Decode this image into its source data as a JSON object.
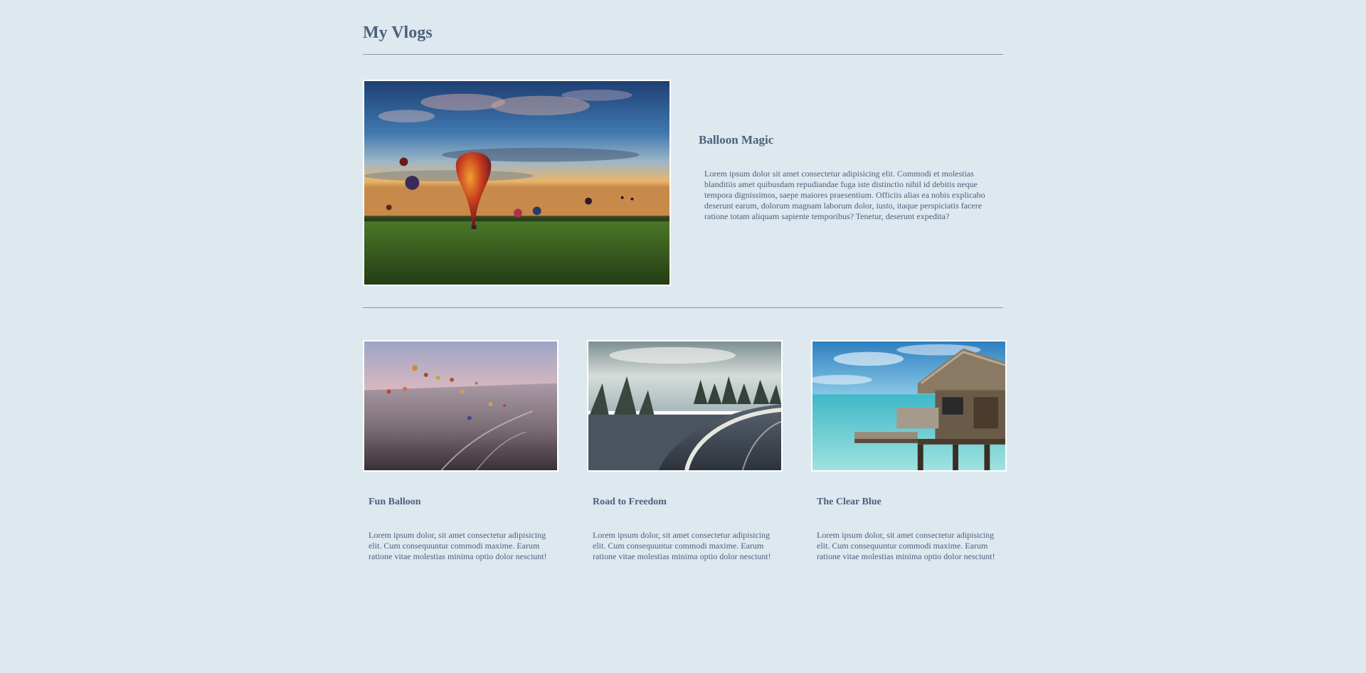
{
  "page": {
    "title": "My Vlogs"
  },
  "featured": {
    "title": "Balloon Magic",
    "text": "Lorem ipsum dolor sit amet consectetur adipisicing elit. Commodi et molestias blanditiis amet quibusdam repudiandae fuga iste distinctio nihil id debitis neque tempora dignissimos, saepe maiores praesentium. Officiis alias ea nobis explicabo deserunt earum, dolorum magnam laborum dolor, iusto, itaque perspiciatis facere ratione totam aliquam sapiente temporibus? Tenetur, deserunt expedita?",
    "image": "hot-air-balloons-sunset-photo"
  },
  "cards": [
    {
      "title": "Fun Balloon",
      "text": "Lorem ipsum dolor, sit amet consectetur adipisicing elit. Cum consequuntur commodi maxime. Earum ratione vitae molestias minima optio dolor nesciunt!",
      "image": "balloons-over-valley-photo"
    },
    {
      "title": "Road to Freedom",
      "text": "Lorem ipsum dolor, sit amet consectetur adipisicing elit. Cum consequuntur commodi maxime. Earum ratione vitae molestias minima optio dolor nesciunt!",
      "image": "curved-road-forest-photo"
    },
    {
      "title": "The Clear Blue",
      "text": "Lorem ipsum dolor, sit amet consectetur adipisicing elit. Cum consequuntur commodi maxime. Earum ratione vitae molestias minima optio dolor nesciunt!",
      "image": "overwater-bungalow-photo"
    }
  ],
  "colors": {
    "background": "#dde8ef",
    "text": "#4d5f7c",
    "divider": "#8a97ad"
  }
}
